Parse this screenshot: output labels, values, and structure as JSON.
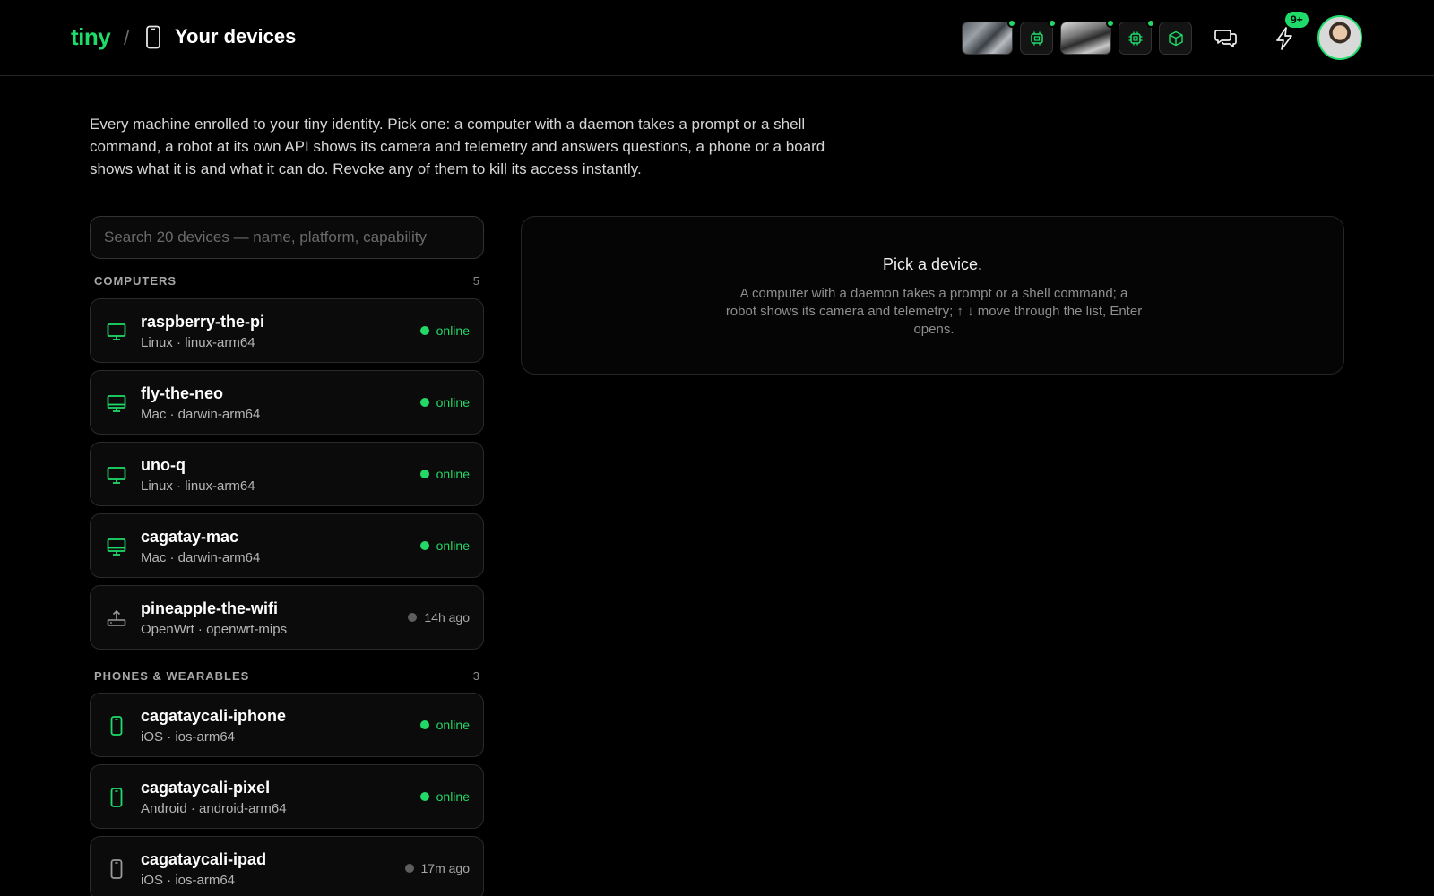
{
  "header": {
    "logo": "tiny",
    "separator": "/",
    "title": "Your devices",
    "notification_badge": "9+",
    "thumbnails": [
      {
        "name": "camera-feed-1",
        "online": true
      },
      {
        "name": "chip-icon",
        "online": true
      },
      {
        "name": "camera-feed-2",
        "online": true
      },
      {
        "name": "processor-icon",
        "online": true
      },
      {
        "name": "cube-icon",
        "online": false
      }
    ],
    "accent": "#1fdc6a"
  },
  "intro": "Every machine enrolled to your tiny identity. Pick one: a computer with a daemon takes a prompt or a shell command, a robot at its own API shows its camera and telemetry and answers questions, a phone or a board shows what it is and what it can do. Revoke any of them to kill its access instantly.",
  "search": {
    "placeholder": "Search 20 devices — name, platform, capability",
    "value": ""
  },
  "groups": [
    {
      "label": "COMPUTERS",
      "count": "5",
      "devices": [
        {
          "name": "raspberry-the-pi",
          "sub": "Linux · linux-arm64",
          "status": "online",
          "icon": "monitor-icon"
        },
        {
          "name": "fly-the-neo",
          "sub": "Mac · darwin-arm64",
          "status": "online",
          "icon": "monitor-icon"
        },
        {
          "name": "uno-q",
          "sub": "Linux · linux-arm64",
          "status": "online",
          "icon": "monitor-icon"
        },
        {
          "name": "cagatay-mac",
          "sub": "Mac · darwin-arm64",
          "status": "online",
          "icon": "monitor-icon"
        },
        {
          "name": "pineapple-the-wifi",
          "sub": "OpenWrt · openwrt-mips",
          "status": "14h ago",
          "icon": "router-icon"
        }
      ]
    },
    {
      "label": "PHONES & WEARABLES",
      "count": "3",
      "devices": [
        {
          "name": "cagataycali-iphone",
          "sub": "iOS · ios-arm64",
          "status": "online",
          "icon": "phone-icon"
        },
        {
          "name": "cagataycali-pixel",
          "sub": "Android · android-arm64",
          "status": "online",
          "icon": "phone-icon"
        },
        {
          "name": "cagataycali-ipad",
          "sub": "iOS · ios-arm64",
          "status": "17m ago",
          "icon": "phone-icon"
        }
      ]
    }
  ],
  "detail": {
    "title": "Pick a device.",
    "body": "A computer with a daemon takes a prompt or a shell command; a robot shows its camera and telemetry; ↑ ↓ move through the list, Enter opens."
  }
}
